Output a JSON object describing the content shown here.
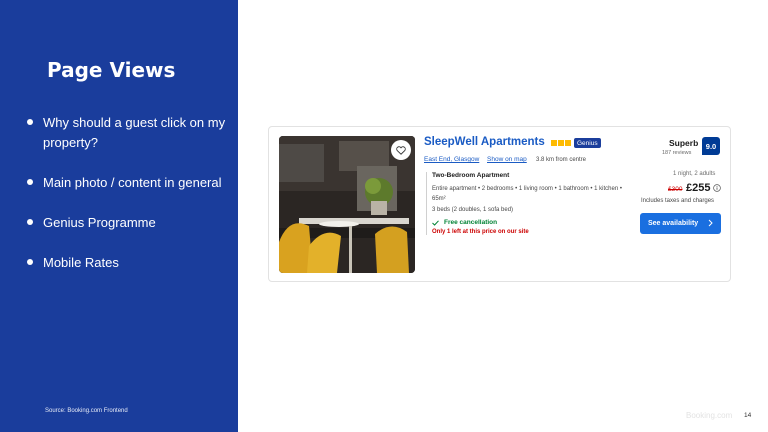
{
  "slide": {
    "title": "Page Views",
    "bullets": [
      "Why should a guest click on my property?",
      "Main photo / content in general",
      "Genius Programme",
      "Mobile Rates"
    ],
    "source": "Source: Booking.com Frontend",
    "brand": "Booking.com",
    "page_number": "14"
  },
  "card": {
    "property_name": "SleepWell Apartments",
    "stars": 3,
    "genius_label": "Genius",
    "location": "East End, Glasgow",
    "show_on_map": "Show on map",
    "distance": "3.8 km from centre",
    "room_type": "Two-Bedroom Apartment",
    "room_desc": "Entire apartment • 2 bedrooms • 1 living room • 1 bathroom • 1 kitchen • 65m²",
    "beds": "3 beds (2 doubles, 1 sofa bed)",
    "free_cancellation": "Free cancellation",
    "scarcity": "Only 1 left at this price on our site",
    "review_word": "Superb",
    "review_count": "187 reviews",
    "score": "9.0",
    "stay_info": "1 night, 2 adults",
    "old_price": "£300",
    "new_price": "£255",
    "tax_note": "Includes taxes and charges",
    "availability_button": "See availability"
  },
  "colors": {
    "panel_blue": "#1a3d9c",
    "link_blue": "#1a5bc4",
    "button_blue": "#1a6fe0",
    "score_blue": "#003b95",
    "star_yellow": "#febb02",
    "green": "#008234",
    "red": "#cc0000"
  },
  "icons": [
    "heart-icon",
    "star-icon",
    "check-icon",
    "info-icon",
    "chevron-right-icon"
  ]
}
